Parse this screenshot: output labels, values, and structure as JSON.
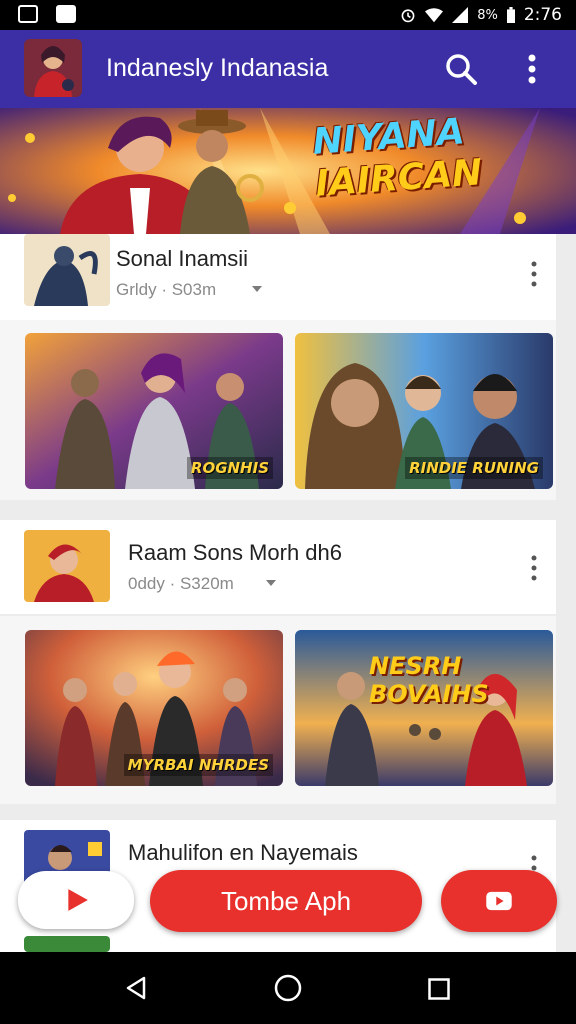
{
  "status_bar": {
    "time": "2:76",
    "battery": "8%"
  },
  "app_bar": {
    "title": "Indanesly Indanasia"
  },
  "banner": {
    "title_line1": "NIYANA",
    "title_line2": "IAIRCAN"
  },
  "items": [
    {
      "title": "Sonal Inamsii",
      "meta": "Grldy · S03m"
    },
    {
      "title": "Raam Sons Morh dh6",
      "meta": "0ddy · S320m"
    },
    {
      "title": "Mahulifon en Nayemais",
      "meta": ""
    }
  ],
  "tiles": [
    {
      "label": "ROGNHIS"
    },
    {
      "label": "RINDIE RUNING"
    },
    {
      "label": "MYRBAI NHRDES"
    },
    {
      "label": "NESRH BOVAIHS"
    }
  ],
  "cta": {
    "label": "Tombe Aph"
  },
  "colors": {
    "app_bar": "#3c2fa6",
    "cta": "#e8312c",
    "youtube_red": "#e8312c"
  },
  "icons": [
    "gallery-icon",
    "notification-icon",
    "alarm-icon",
    "wifi-icon",
    "signal-icon",
    "battery-icon",
    "search-icon",
    "more-vert-icon",
    "chevron-down-icon",
    "play-icon",
    "back-icon",
    "home-icon",
    "recents-icon"
  ]
}
